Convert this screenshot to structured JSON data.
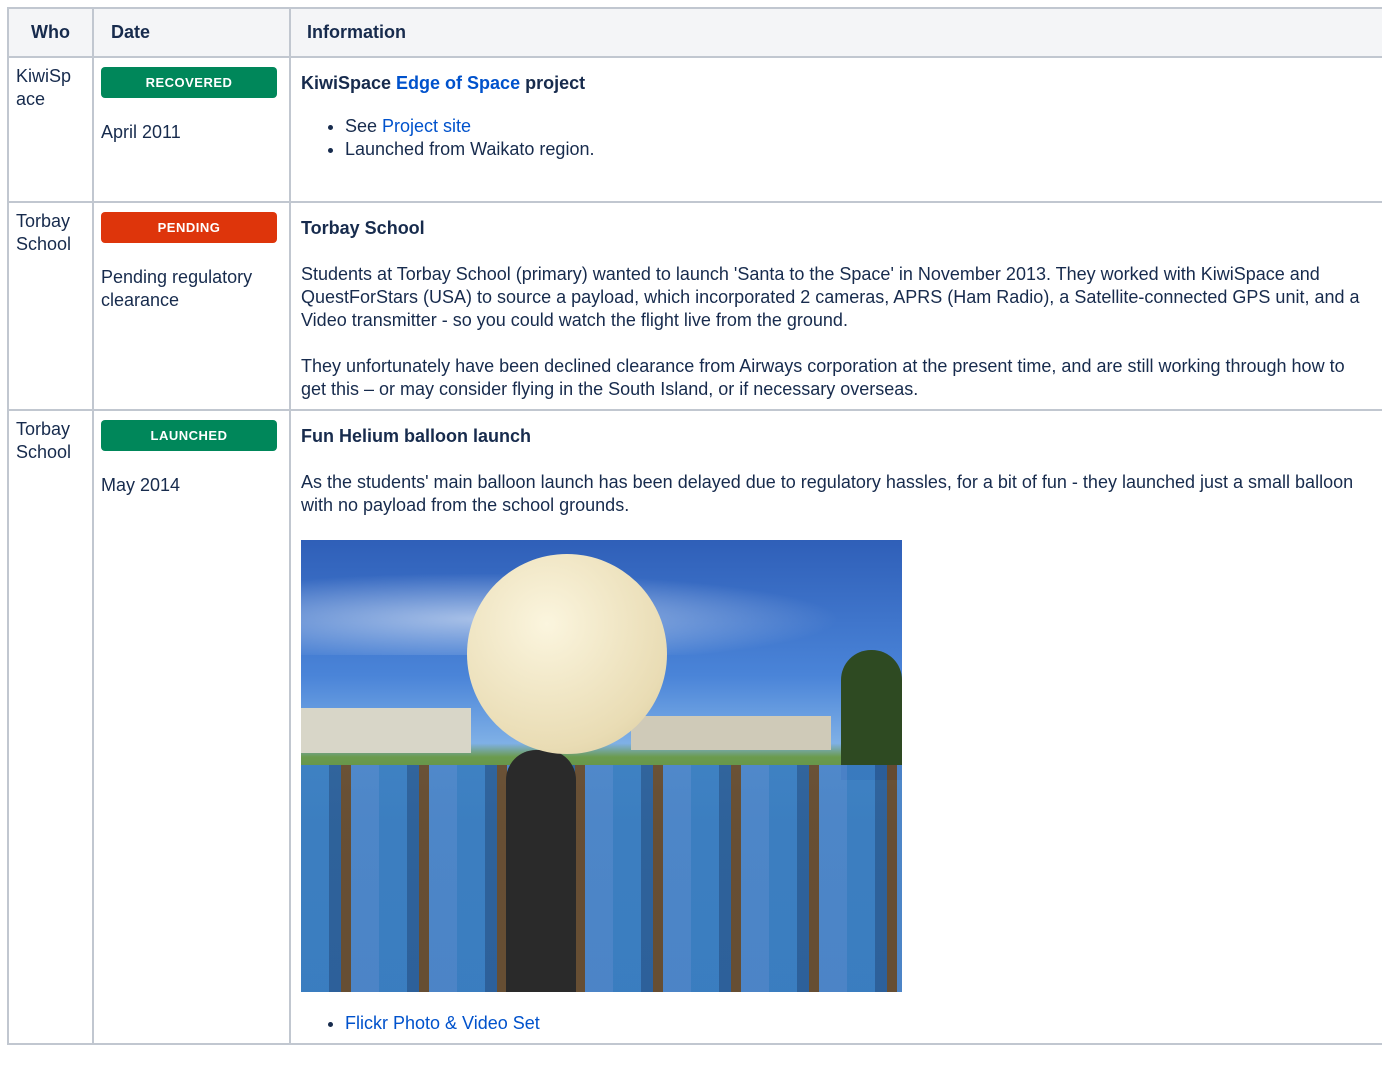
{
  "headers": {
    "who": "Who",
    "date": "Date",
    "info": "Information"
  },
  "rows": [
    {
      "who": "KiwiSp ace",
      "status": "RECOVERED",
      "status_color": "#00875a",
      "date": "April 2011",
      "title_pre": "KiwiSpace ",
      "title_link": "Edge of Space",
      "title_post": " project",
      "bullets": [
        {
          "pre": "See ",
          "link": "Project site"
        },
        {
          "text": "Launched from Waikato region."
        }
      ]
    },
    {
      "who": "Torbay School",
      "status": "PENDING",
      "status_color": "#de350b",
      "date": "Pending regulatory clearance",
      "title": "Torbay School",
      "paragraphs": [
        "Students at Torbay School (primary) wanted to launch 'Santa to the Space' in November 2013. They worked with KiwiSpace and QuestForStars (USA) to source a payload, which incorporated 2 cameras, APRS (Ham Radio), a Satellite-connected GPS unit, and a Video transmitter - so you could watch the flight live from the ground.",
        "They unfortunately have been declined clearance from Airways corporation at the present time, and are still working through how to get this – or may consider flying in the South Island, or if necessary overseas."
      ]
    },
    {
      "who": "Torbay School",
      "status": "LAUNCHED",
      "status_color": "#00875a",
      "date": "May 2014",
      "title": "Fun Helium balloon launch",
      "paragraphs": [
        "As the students' main balloon launch has been delayed due to regulatory hassles, for a bit of fun - they launched just a small balloon with no payload from the school grounds."
      ],
      "bullets": [
        {
          "link": "Flickr Photo & Video Set"
        }
      ]
    }
  ]
}
